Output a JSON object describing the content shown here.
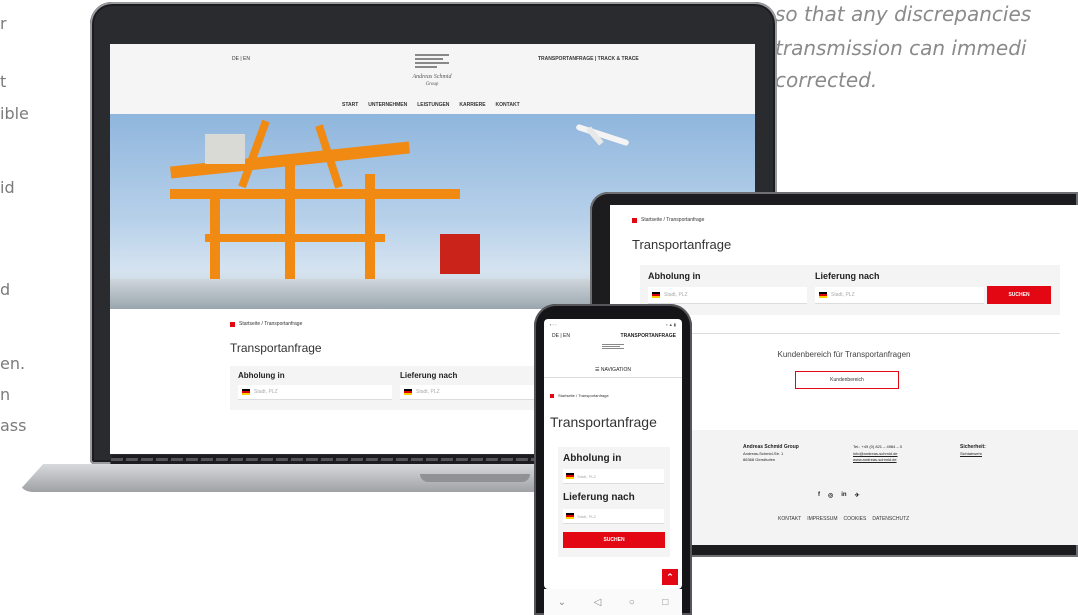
{
  "left_fragment": [
    "r",
    "t",
    "ible",
    "id",
    "d",
    "en.",
    "n",
    "ass"
  ],
  "quote_lines": [
    "so that any discrepancies",
    "transmission can immedi",
    "corrected."
  ],
  "site": {
    "lang": "DE | EN",
    "top_links": "TRANSPORTANFRAGE | TRACK & TRACE",
    "company": "Andreas Schmid",
    "company_sub": "Group",
    "nav": [
      "START",
      "UNTERNEHMEN",
      "LEISTUNGEN",
      "KARRIERE",
      "KONTAKT"
    ],
    "breadcrumb": "Startseite / Transportanfrage",
    "page_title": "Transportanfrage",
    "pickup_label": "Abholung in",
    "delivery_label": "Lieferung nach",
    "placeholder": "Stadt, PLZ",
    "search_button": "SUCHEN"
  },
  "tablet": {
    "customer_area_text": "Kundenbereich für Transportanfragen",
    "customer_area_button": "Kundenbereich",
    "footer_company": "Andreas Schmid Group",
    "footer_address_1": "Andreas-Schmid-Str. 1",
    "footer_address_2": "86368 Gersthofen",
    "footer_phone": "Tel.: +49 (0) 821 – 4984 – 0",
    "footer_email": "info@andreas-schmid.de",
    "footer_web": "www.andreas-schmid.de",
    "footer_security_title": "Sicherheit:",
    "footer_security_link": "Sichtabwehr",
    "footer_links": [
      "KONTAKT",
      "IMPRESSUM",
      "COOKIES",
      "DATENSCHUTZ"
    ],
    "social_icons": [
      "f",
      "◎",
      "in",
      "✈"
    ]
  },
  "phone": {
    "status_left": "▪ ◦ ◦",
    "status_right": "▪ ▲ ▮",
    "lang": "DE | EN",
    "top_link": "TRANSPORTANFRAGE",
    "nav_label": "NAVIGATION",
    "scroll_top": "⌃",
    "android_nav": [
      "⌄",
      "◁",
      "○",
      "□"
    ]
  }
}
